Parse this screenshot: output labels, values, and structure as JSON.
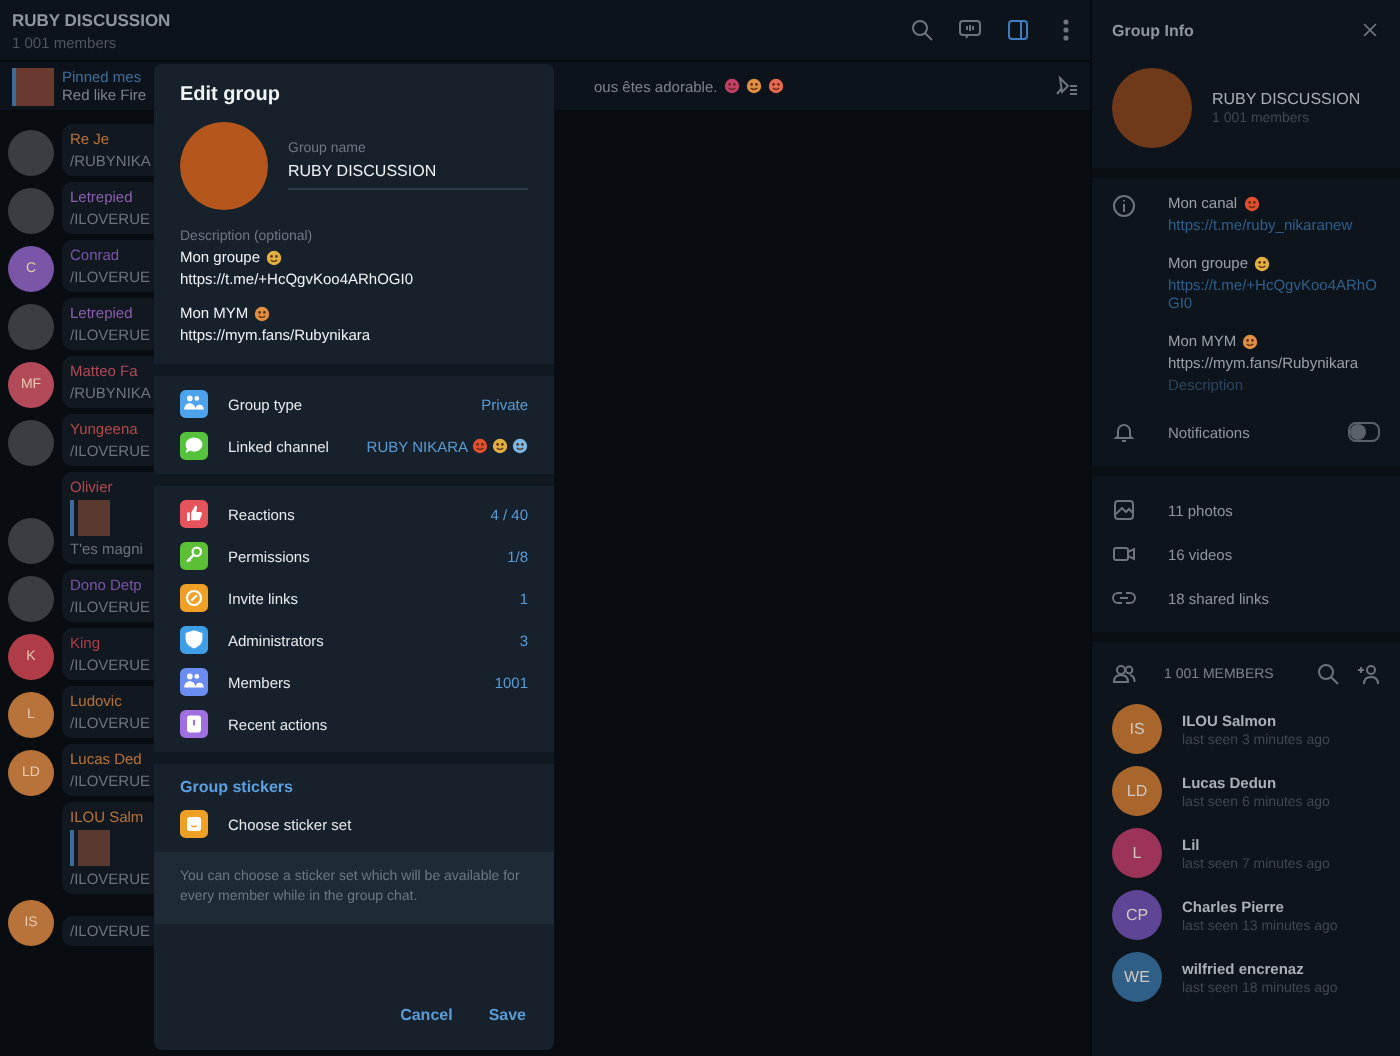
{
  "chat": {
    "title": "RUBY DISCUSSION",
    "subtitle": "1 001 members",
    "pinned": {
      "label": "Pinned mes",
      "text": "Red like Fire",
      "message": "ous êtes adorable."
    },
    "messages": [
      {
        "kind": "plain",
        "name": "Re Je",
        "text": "/RUBYNIKA",
        "color": "#b8733a",
        "avatar": {
          "kind": "photo"
        }
      },
      {
        "kind": "plain",
        "name": "Letrepied",
        "text": "/ILOVERUE",
        "color": "#8a5fb0",
        "avatar": {
          "kind": "photo"
        }
      },
      {
        "kind": "plain",
        "name": "Conrad",
        "text": "/ILOVERUE",
        "color": "#7a55a8",
        "avatar": {
          "kind": "initials",
          "text": "C"
        }
      },
      {
        "kind": "plain",
        "name": "Letrepied",
        "text": "/ILOVERUE",
        "color": "#8a5fb0",
        "avatar": {
          "kind": "photo"
        }
      },
      {
        "kind": "plain",
        "name": "Matteo Fa",
        "text": "/RUBYNIKA",
        "color": "#b24a5a",
        "avatar": {
          "kind": "initials",
          "text": "MF"
        }
      },
      {
        "kind": "plain",
        "name": "Yungeena",
        "text": "/ILOVERUE",
        "color": "#b24a4a",
        "avatar": {
          "kind": "photo"
        }
      },
      {
        "kind": "reply",
        "name": "Olivier",
        "text": "T'es magni",
        "color": "#b24a4a",
        "avatar": {
          "kind": "photo"
        }
      },
      {
        "kind": "plain",
        "name": "Dono Detp",
        "text": "/ILOVERUE",
        "color": "#7a55a8",
        "avatar": {
          "kind": "photo"
        }
      },
      {
        "kind": "plain",
        "name": "King",
        "text": "/ILOVERUE",
        "color": "#b03c48",
        "avatar": {
          "kind": "initials",
          "text": "K"
        }
      },
      {
        "kind": "plain",
        "name": "Ludovic",
        "text": "/ILOVERUE",
        "color": "#b8733a",
        "avatar": {
          "kind": "initials",
          "text": "L"
        }
      },
      {
        "kind": "plain",
        "name": "Lucas Ded",
        "text": "/ILOVERUE",
        "color": "#b8733a",
        "avatar": {
          "kind": "initials",
          "text": "LD"
        }
      },
      {
        "kind": "reply",
        "name": "ILOU Salm",
        "text": "/ILOVERUE",
        "color": "#b8733a"
      },
      {
        "kind": "textonly",
        "text": "/ILOVERUE",
        "color": "#b8733a",
        "avatar": {
          "kind": "initials",
          "text": "IS"
        }
      }
    ]
  },
  "dialog": {
    "title": "Edit group",
    "name_label": "Group name",
    "name_value": "RUBY DISCUSSION",
    "description_label": "Description (optional)",
    "description": [
      {
        "title": "Mon groupe",
        "link": "https://t.me/+HcQgvKoo4ARhOGI0"
      },
      {
        "title": "Mon MYM",
        "link": "https://mym.fans/Rubynikara"
      }
    ],
    "settings": [
      {
        "label": "Group type",
        "value": "Private",
        "color": "#4ea4ec"
      },
      {
        "label": "Linked channel",
        "value": "RUBY NIKARA",
        "color": "#56c23c"
      }
    ],
    "manage": [
      {
        "label": "Reactions",
        "value": "4 / 40",
        "color": "#e5545a"
      },
      {
        "label": "Permissions",
        "value": "1/8",
        "color": "#5cbf36"
      },
      {
        "label": "Invite links",
        "value": "1",
        "color": "#f0a024"
      },
      {
        "label": "Administrators",
        "value": "3",
        "color": "#3f9ee8"
      },
      {
        "label": "Members",
        "value": "1001",
        "color": "#6b8cf0"
      },
      {
        "label": "Recent actions",
        "color": "#a06fe0"
      }
    ],
    "stickers_heading": "Group stickers",
    "sticker_item": {
      "label": "Choose sticker set",
      "color": "#f0a024"
    },
    "note": "You can choose a sticker set which will be available for every member while in the group chat.",
    "buttons": [
      "Cancel",
      "Save"
    ]
  },
  "info": {
    "title": "Group Info",
    "name": "RUBY DISCUSSION",
    "members": "1 001 members",
    "about": [
      {
        "title": "Mon canal",
        "link": "https://t.me/ruby_nikaranew",
        "kind": "link"
      },
      {
        "title": "Mon groupe",
        "link": "https://t.me/+HcQgvKoo4ARhOGI0",
        "kind": "link"
      },
      {
        "title": "Mon MYM",
        "link": "https://mym.fans/Rubynikara",
        "kind": "plain"
      }
    ],
    "about_label": "Description",
    "notifications": {
      "label": "Notifications",
      "on": false
    },
    "media": [
      "11 photos",
      "16 videos",
      "18 shared links"
    ],
    "members_heading": "1 001 MEMBERS",
    "member_list": [
      {
        "initials": "IS",
        "name": "ILOU Salmon",
        "status": "last seen 3 minutes ago",
        "color": "#a8662c"
      },
      {
        "initials": "LD",
        "name": "Lucas Dedun",
        "status": "last seen 6 minutes ago",
        "color": "#a8662c"
      },
      {
        "initials": "L",
        "name": "Lil",
        "status": "last seen 7 minutes ago",
        "color": "#9c3358"
      },
      {
        "initials": "CP",
        "name": "Charles Pierre",
        "status": "last seen 13 minutes ago",
        "color": "#5f4596"
      },
      {
        "initials": "WE",
        "name": "wilfried encrenaz",
        "status": "last seen 18 minutes ago",
        "color": "#2f5f86"
      }
    ]
  }
}
